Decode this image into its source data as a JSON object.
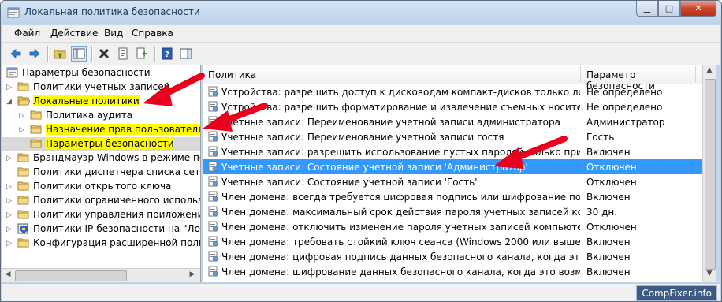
{
  "window": {
    "title": "Локальная политика безопасности"
  },
  "menu": [
    "Файл",
    "Действие",
    "Вид",
    "Справка"
  ],
  "tree": [
    {
      "label": "Параметры безопасности",
      "highlight": false
    },
    {
      "label": "Политики учетных записей",
      "highlight": false
    },
    {
      "label": "Локальные политики",
      "highlight": true
    },
    {
      "label": "Политика аудита",
      "highlight": false
    },
    {
      "label": "Назначение прав пользователя",
      "highlight": true
    },
    {
      "label": "Параметры безопасности",
      "highlight": true
    },
    {
      "label": "Брандмауэр Windows в режиме повышенной безопасности",
      "highlight": false
    },
    {
      "label": "Политики диспетчера списка сетей",
      "highlight": false
    },
    {
      "label": "Политики открытого ключа",
      "highlight": false
    },
    {
      "label": "Политики ограниченного использования программ",
      "highlight": false
    },
    {
      "label": "Политики управления приложениями",
      "highlight": false
    },
    {
      "label": "Политики IP-безопасности на \"Локальный компьютер\"",
      "highlight": false
    },
    {
      "label": "Конфигурация расширенной политики аудита",
      "highlight": false
    }
  ],
  "list": {
    "col_policy": "Политика",
    "col_setting": "Параметр безопасности",
    "rows": [
      {
        "policy": "Устройства: разрешить доступ к дисководам компакт-дисков только локальным пользователям",
        "setting": "Не определено"
      },
      {
        "policy": "Устройства: разрешить форматирование и извлечение съемных носителей",
        "setting": "Не определено"
      },
      {
        "policy": "Учетные записи: Переименование учетной записи администратора",
        "setting": "Администратор"
      },
      {
        "policy": "Учетные записи: Переименование учетной записи гостя",
        "setting": "Гость"
      },
      {
        "policy": "Учетные записи: разрешить использование пустых паролей только при консольном входе",
        "setting": "Включен"
      },
      {
        "policy": "Учетные записи: Состояние учетной записи 'Администратор'",
        "setting": "Отключен",
        "selected": true
      },
      {
        "policy": "Учетные записи: Состояние учетной записи 'Гость'",
        "setting": "Отключен"
      },
      {
        "policy": "Член домена: всегда требуется цифровая подпись или шифрование потока данных безопасного канала",
        "setting": "Включен"
      },
      {
        "policy": "Член домена: максимальный срок действия пароля учетных записей компьютера",
        "setting": "30 дн."
      },
      {
        "policy": "Член домена: отключить изменение пароля учетных записей компьютера",
        "setting": "Отключен"
      },
      {
        "policy": "Член домена: требовать стойкий ключ сеанса (Windows 2000 или выше)",
        "setting": "Включен"
      },
      {
        "policy": "Член домена: цифровая подпись данных безопасного канала, когда это возможно",
        "setting": "Включен"
      },
      {
        "policy": "Член домена: шифрование данных безопасного канала, когда это возможно",
        "setting": "Включен"
      }
    ]
  },
  "watermark": "CompFixer.info",
  "colors": {
    "highlight": "#ffff00",
    "selection": "#3399ff",
    "arrow": "#e8001c"
  }
}
